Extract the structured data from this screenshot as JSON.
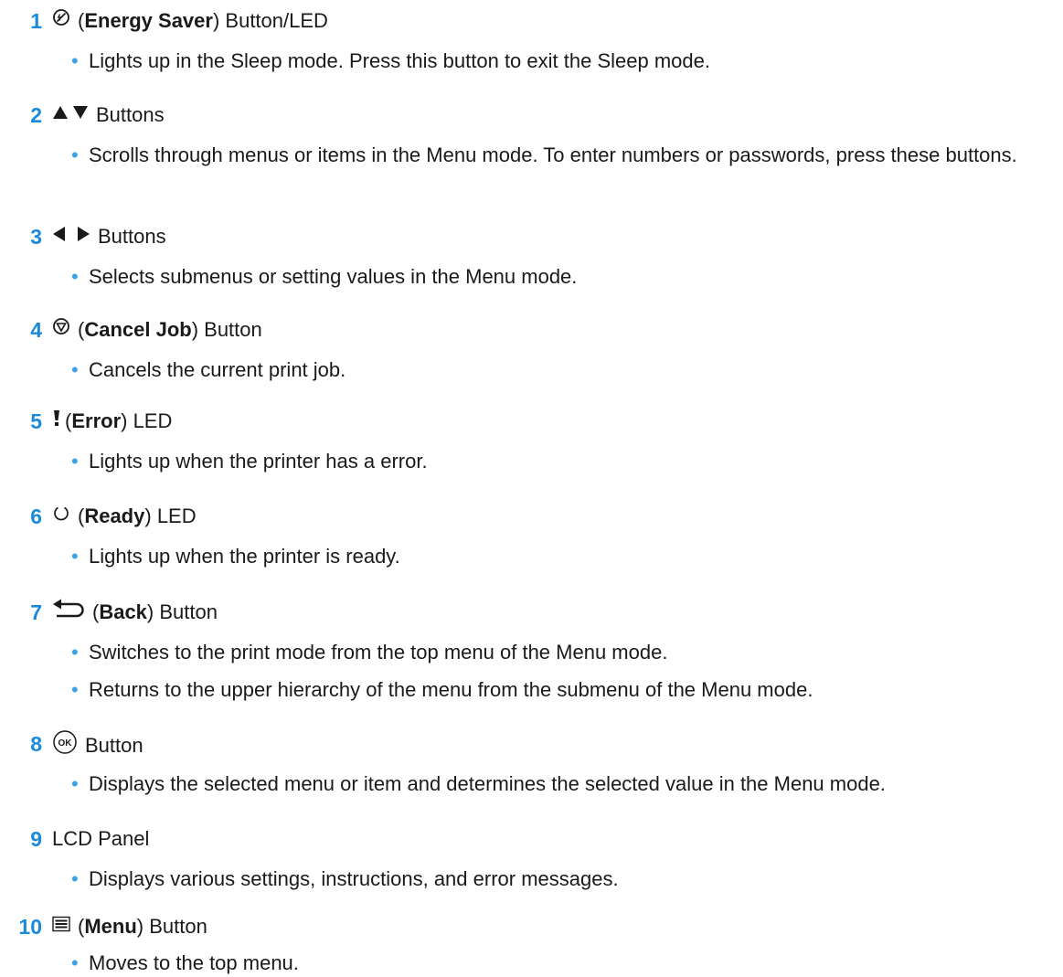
{
  "items": [
    {
      "number": "1",
      "icon": "energy-saver-icon",
      "name": "Energy Saver",
      "before": "(",
      "after": ") Button/LED",
      "bullets": [
        "Lights up in the Sleep mode. Press this button to exit the Sleep mode."
      ]
    },
    {
      "number": "2",
      "icon": "up-down-arrows-icon",
      "label": "Buttons",
      "bullets": [
        "Scrolls through menus or items in the Menu mode. To enter numbers or passwords, press these buttons."
      ]
    },
    {
      "number": "3",
      "icon": "left-right-arrows-icon",
      "label": "Buttons",
      "bullets": [
        "Selects submenus or setting values in the Menu mode."
      ]
    },
    {
      "number": "4",
      "icon": "cancel-job-icon",
      "name": "Cancel Job",
      "before": "(",
      "after": ") Button",
      "bullets": [
        "Cancels the current print job."
      ]
    },
    {
      "number": "5",
      "icon": "error-icon",
      "name": "Error",
      "before": "(",
      "after": ") LED",
      "bullets": [
        "Lights up when the printer has a error."
      ]
    },
    {
      "number": "6",
      "icon": "ready-icon",
      "name": "Ready",
      "before": "(",
      "after": ") LED",
      "bullets": [
        "Lights up when the printer is ready."
      ]
    },
    {
      "number": "7",
      "icon": "back-arrow-icon",
      "name": "Back",
      "before": "(",
      "after": ") Button",
      "bullets": [
        "Switches to the print mode from the top menu of the Menu mode.",
        "Returns to the upper hierarchy of the menu from the submenu of the Menu mode."
      ]
    },
    {
      "number": "8",
      "icon": "ok-button-icon",
      "icon_text": "OK",
      "label": "Button",
      "bullets": [
        "Displays the selected menu or item and determines the selected value in the Menu mode."
      ]
    },
    {
      "number": "9",
      "label": "LCD Panel",
      "bullets": [
        "Displays various settings, instructions, and error messages."
      ]
    },
    {
      "number": "10",
      "icon": "menu-icon",
      "name": "Menu",
      "before": "(",
      "after": ") Button",
      "bullets": [
        "Moves to the top menu."
      ]
    }
  ],
  "colors": {
    "accent": "#1a8ad9",
    "bullet": "#3aa2e8",
    "text": "#1a1a1a"
  },
  "bullet_glyph": "•"
}
